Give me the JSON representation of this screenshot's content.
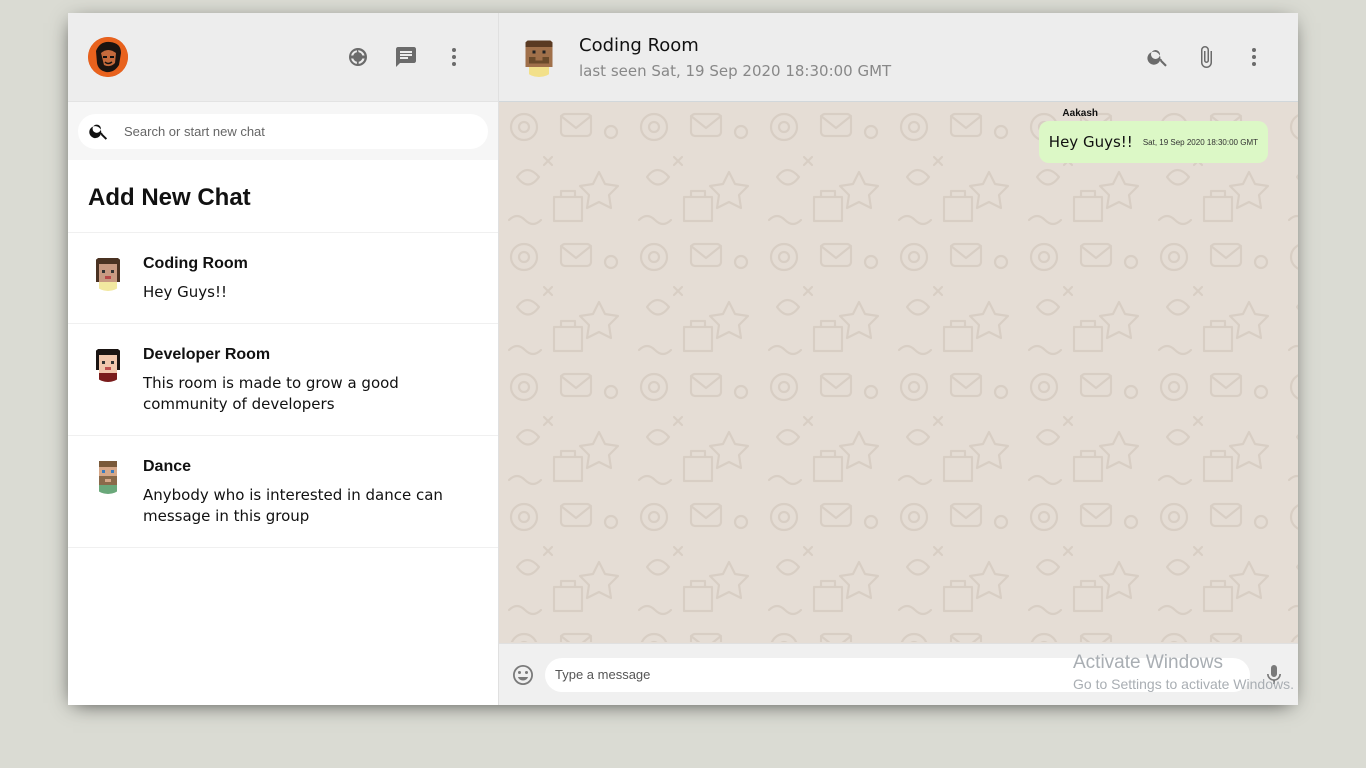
{
  "sidebar": {
    "header": {
      "avatar_icon": "user-avatar",
      "icons": [
        "status-icon",
        "new-chat-icon",
        "more-vert-icon"
      ]
    },
    "search": {
      "placeholder": "Search or start new chat"
    },
    "add_new_chat": "Add New Chat",
    "chats": [
      {
        "name": "Coding Room",
        "last_message": "Hey Guys!!",
        "avatar_icon": "pixel-avatar-pink"
      },
      {
        "name": "Developer Room",
        "last_message": "This room is made to grow a good community of developers",
        "avatar_icon": "pixel-avatar-dark"
      },
      {
        "name": "Dance",
        "last_message": "Anybody who is interested in dance can message in this group",
        "avatar_icon": "pixel-avatar-beard"
      }
    ]
  },
  "chat": {
    "header": {
      "name": "Coding Room",
      "last_seen": "last seen Sat, 19 Sep 2020 18:30:00 GMT",
      "avatar_icon": "pixel-avatar-brown"
    },
    "messages": [
      {
        "sender": "Aakash",
        "text": "Hey Guys!!",
        "timestamp": "Sat, 19 Sep 2020 18:30:00 GMT",
        "is_own": true
      }
    ],
    "footer": {
      "placeholder": "Type a message"
    }
  },
  "watermark": {
    "line1": "Activate Windows",
    "line2": "Go to Settings to activate Windows."
  },
  "colors": {
    "page_background": "#dadbd3",
    "header_background": "#ededed",
    "chat_background": "#e5ddd5",
    "own_message_bubble": "#dcf8c6"
  }
}
